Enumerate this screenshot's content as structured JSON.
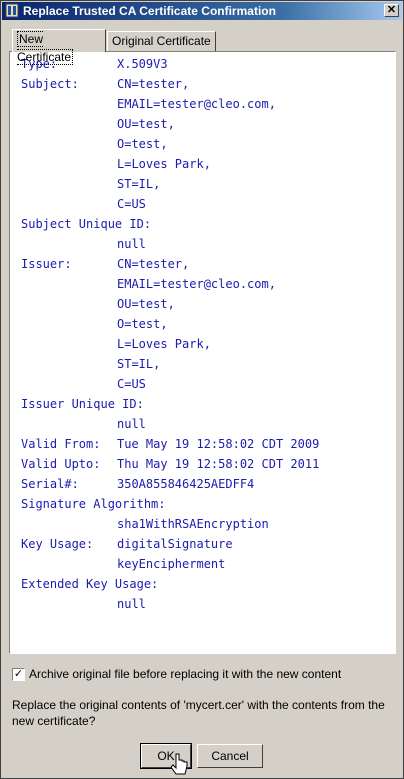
{
  "window": {
    "title": "Replace Trusted CA Certificate Confirmation",
    "close_glyph": "✕"
  },
  "tabs": [
    {
      "label": "New Certificate",
      "active": true
    },
    {
      "label": "Original Certificate",
      "active": false
    }
  ],
  "certificate": {
    "lines": [
      {
        "key": "Type:",
        "value": "X.509V3"
      },
      {
        "key": "Subject:",
        "value": "CN=tester,"
      },
      {
        "key": "",
        "value": "EMAIL=tester@cleo.com,"
      },
      {
        "key": "",
        "value": "OU=test,"
      },
      {
        "key": "",
        "value": "O=test,"
      },
      {
        "key": "",
        "value": "L=Loves Park,"
      },
      {
        "key": "",
        "value": "ST=IL,"
      },
      {
        "key": "",
        "value": "C=US"
      },
      {
        "key": "Subject Unique ID:",
        "value": ""
      },
      {
        "key": "",
        "value": "null"
      },
      {
        "key": "Issuer:",
        "value": "CN=tester,"
      },
      {
        "key": "",
        "value": "EMAIL=tester@cleo.com,"
      },
      {
        "key": "",
        "value": "OU=test,"
      },
      {
        "key": "",
        "value": "O=test,"
      },
      {
        "key": "",
        "value": "L=Loves Park,"
      },
      {
        "key": "",
        "value": "ST=IL,"
      },
      {
        "key": "",
        "value": "C=US"
      },
      {
        "key": "Issuer Unique ID:",
        "value": ""
      },
      {
        "key": "",
        "value": "null"
      },
      {
        "key": "Valid From:",
        "value": "Tue May 19 12:58:02 CDT 2009"
      },
      {
        "key": "Valid Upto:",
        "value": "Thu May 19 12:58:02 CDT 2011"
      },
      {
        "key": "Serial#:",
        "value": "350A855846425AEDFF4"
      },
      {
        "key": "Signature Algorithm:",
        "value": ""
      },
      {
        "key": "",
        "value": "sha1WithRSAEncryption"
      },
      {
        "key": "Key Usage:",
        "value": "digitalSignature"
      },
      {
        "key": "",
        "value": "keyEncipherment"
      },
      {
        "key": "Extended Key Usage:",
        "value": ""
      },
      {
        "key": "",
        "value": "null"
      }
    ]
  },
  "archive": {
    "checked": true,
    "check_glyph": "✓",
    "label": "Archive original file before replacing it with the new content"
  },
  "question": "Replace the original contents of 'mycert.cer' with the contents from the new certificate?",
  "buttons": {
    "ok": "OK",
    "cancel": "Cancel"
  },
  "colors": {
    "cert_text": "#1b1bb0",
    "titlebar_start": "#0a246a",
    "titlebar_end": "#a6caf0",
    "dialog_bg": "#d4d0c8"
  }
}
